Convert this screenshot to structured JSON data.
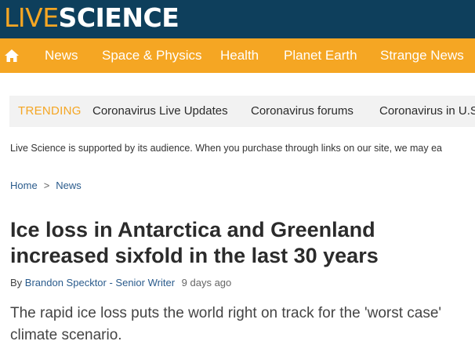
{
  "header": {
    "logo": {
      "live": "LIVE",
      "science": "SCIENCE"
    },
    "colors": {
      "brand_dark": "#0e3f5c",
      "accent": "#f5a623"
    }
  },
  "nav": {
    "home_icon": "home-icon",
    "items": [
      "News",
      "Space & Physics",
      "Health",
      "Planet Earth",
      "Strange News"
    ]
  },
  "trending": {
    "label": "TRENDING",
    "links": [
      "Coronavirus Live Updates",
      "Coronavirus forums",
      "Coronavirus in U.S"
    ]
  },
  "disclaimer": "Live Science is supported by its audience. When you purchase through links on our site, we may ea",
  "breadcrumb": {
    "home": "Home",
    "separator": ">",
    "section": "News"
  },
  "article": {
    "title": "Ice loss in Antarctica and Greenland increased sixfold in the last 30 years",
    "byline_prefix": "By",
    "author": "Brandon Specktor - Senior Writer",
    "time": "9 days ago",
    "standfirst": "The rapid ice loss puts the world right on track for the 'worst case' climate scenario."
  }
}
